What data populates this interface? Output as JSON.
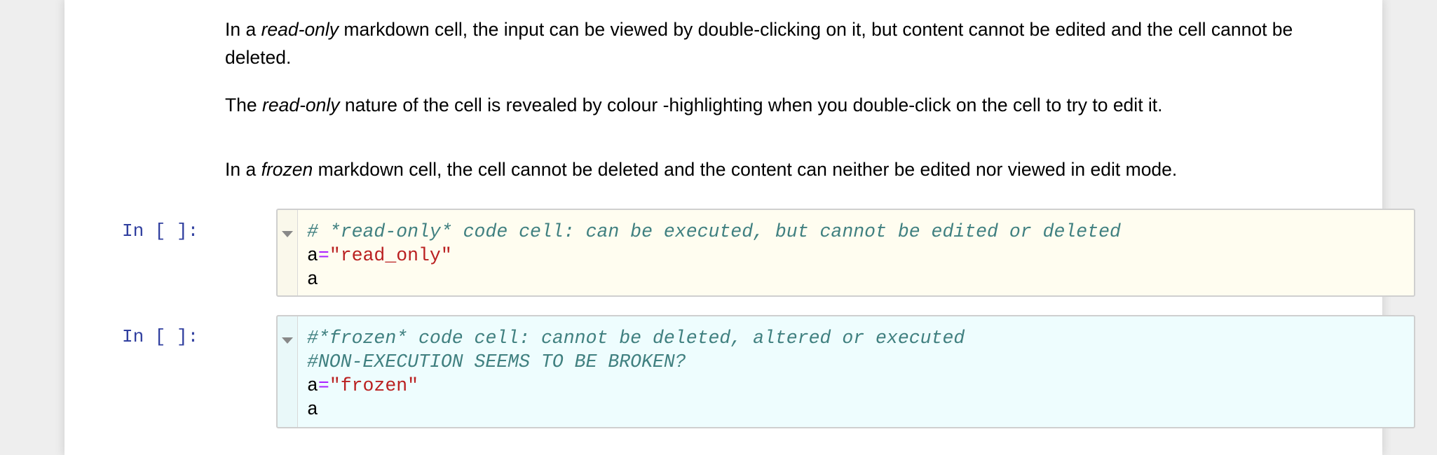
{
  "markdown": {
    "readonly_para1": {
      "pre": "In a ",
      "em": "read-only",
      "post": " markdown cell, the input can be viewed by double-clicking on it, but content cannot be edited and the cell cannot be deleted."
    },
    "readonly_para2": {
      "pre": "The ",
      "em": "read-only",
      "post": " nature of the cell is revealed by colour -highlighting when you double-click on the cell to try to edit it."
    },
    "frozen_para": {
      "pre": "In a ",
      "em": "frozen",
      "post": " markdown cell, the cell cannot be deleted and the content can neither be edited nor viewed in edit mode."
    }
  },
  "cells": [
    {
      "prompt": "In [ ]:",
      "background": "#fffdf0",
      "comment1": "# *read-only* code cell: can be executed, but cannot be edited or deleted",
      "var": "a",
      "op": "=",
      "string": "\"read_only\"",
      "last": "a"
    },
    {
      "prompt": "In [ ]:",
      "background": "#eefdfe",
      "comment1": "#*frozen* code cell: cannot be deleted, altered or executed",
      "comment2": "#NON-EXECUTION SEEMS TO BE BROKEN?",
      "var": "a",
      "op": "=",
      "string": "\"frozen\"",
      "last": "a"
    }
  ]
}
